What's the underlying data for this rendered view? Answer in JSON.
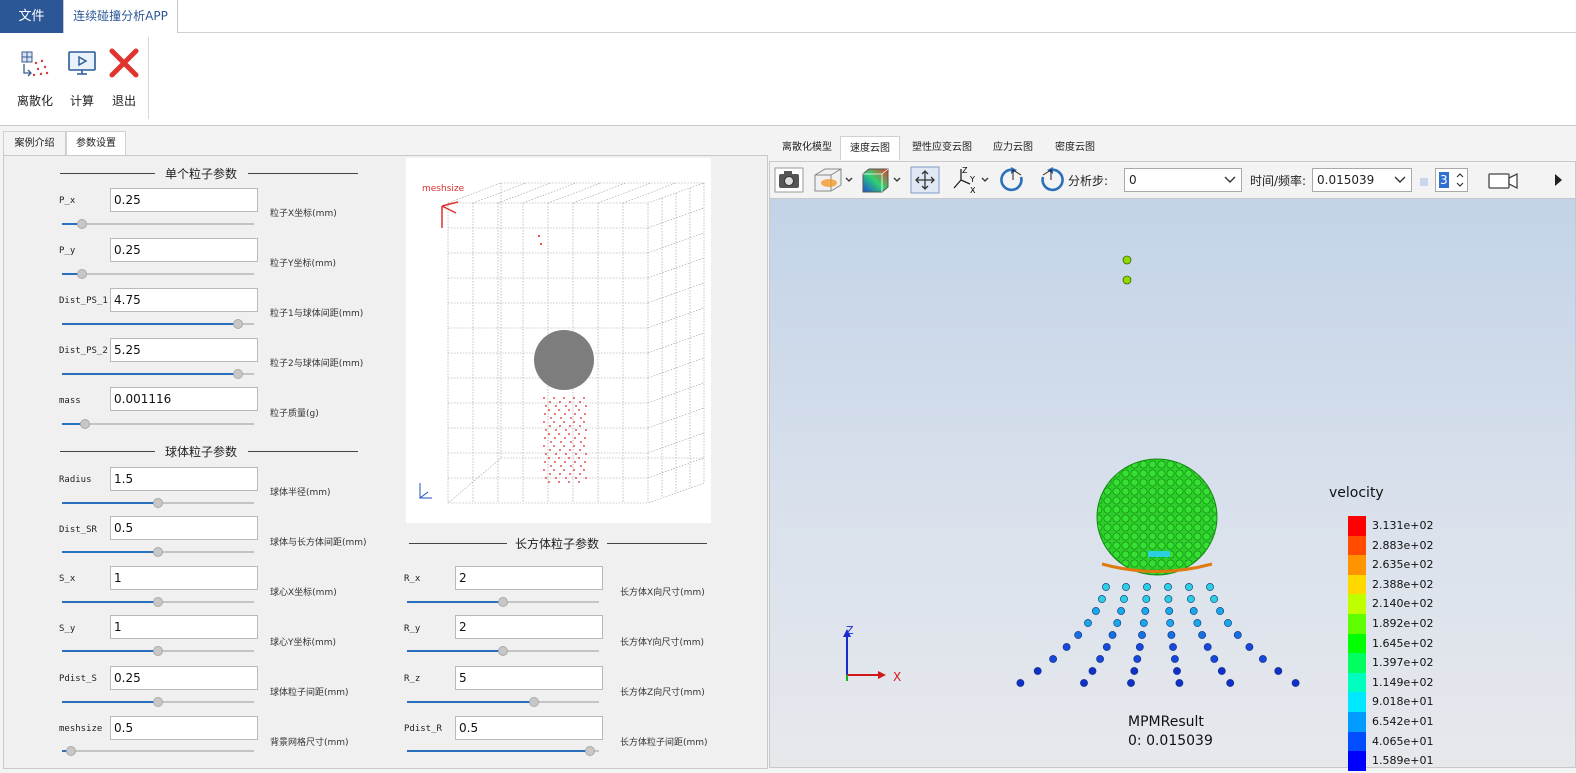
{
  "menu": {
    "file": "文件",
    "app_tab": "连续碰撞分析APP"
  },
  "ribbon": {
    "discretize": "离散化",
    "compute": "计算",
    "exit": "退出"
  },
  "left_tabs": [
    "案例介绍",
    "参数设置"
  ],
  "sections": {
    "single": "单个粒子参数",
    "sphere": "球体粒子参数",
    "cuboid": "长方体粒子参数"
  },
  "single_params": [
    {
      "label": "P_x",
      "value": "0.25",
      "desc": "粒子X坐标(mm)",
      "level": 0.08
    },
    {
      "label": "P_y",
      "value": "0.25",
      "desc": "粒子Y坐标(mm)",
      "level": 0.08
    },
    {
      "label": "Dist_PS_1",
      "value": "4.75",
      "desc": "粒子1与球体间距(mm)",
      "level": 0.94
    },
    {
      "label": "Dist_PS_2",
      "value": "5.25",
      "desc": "粒子2与球体间距(mm)",
      "level": 0.94
    },
    {
      "label": "mass",
      "value": "0.001116",
      "desc": "粒子质量(g)",
      "level": 0.1
    }
  ],
  "sphere_params": [
    {
      "label": "Radius",
      "value": "1.5",
      "desc": "球体半径(mm)",
      "level": 0.5
    },
    {
      "label": "Dist_SR",
      "value": "0.5",
      "desc": "球体与长方体间距(mm)",
      "level": 0.5
    },
    {
      "label": "S_x",
      "value": "1",
      "desc": "球心X坐标(mm)",
      "level": 0.5
    },
    {
      "label": "S_y",
      "value": "1",
      "desc": "球心Y坐标(mm)",
      "level": 0.5
    },
    {
      "label": "Pdist_S",
      "value": "0.25",
      "desc": "球体粒子间距(mm)",
      "level": 0.5
    },
    {
      "label": "meshsize",
      "value": "0.5",
      "desc": "背景网格尺寸(mm)",
      "level": 0.02
    }
  ],
  "cuboid_params": [
    {
      "label": "R_x",
      "value": "2",
      "desc": "长方体X向尺寸(mm)",
      "level": 0.5
    },
    {
      "label": "R_y",
      "value": "2",
      "desc": "长方体Y向尺寸(mm)",
      "level": 0.5
    },
    {
      "label": "R_z",
      "value": "5",
      "desc": "长方体Z向尺寸(mm)",
      "level": 0.67
    },
    {
      "label": "Pdist_R",
      "value": "0.5",
      "desc": "长方体粒子间距(mm)",
      "level": 0.98
    }
  ],
  "preview": {
    "label": "meshsize"
  },
  "right_tabs": [
    "离散化模型",
    "速度云图",
    "塑性应变云图",
    "应力云图",
    "密度云图"
  ],
  "toolbar": {
    "step_label": "分析步:",
    "step_value": "0",
    "time_label": "时间/频率:",
    "time_value": "0.015039",
    "spin_value": "3"
  },
  "viewport": {
    "legend_title": "velocity",
    "legend_values": [
      "3.131e+02",
      "2.883e+02",
      "2.635e+02",
      "2.388e+02",
      "2.140e+02",
      "1.892e+02",
      "1.645e+02",
      "1.397e+02",
      "1.149e+02",
      "9.018e+01",
      "6.542e+01",
      "4.065e+01",
      "1.589e+01"
    ],
    "legend_colors": [
      "#ff0000",
      "#ff4a00",
      "#ff9400",
      "#ffd800",
      "#bfff00",
      "#60ff00",
      "#00ff00",
      "#00ff60",
      "#00ffbf",
      "#00e8ff",
      "#009cff",
      "#004eff",
      "#0000ff"
    ],
    "result_name": "MPMResult",
    "result_step": "0: 0.015039",
    "axis_z": "Z",
    "axis_x": "X"
  }
}
